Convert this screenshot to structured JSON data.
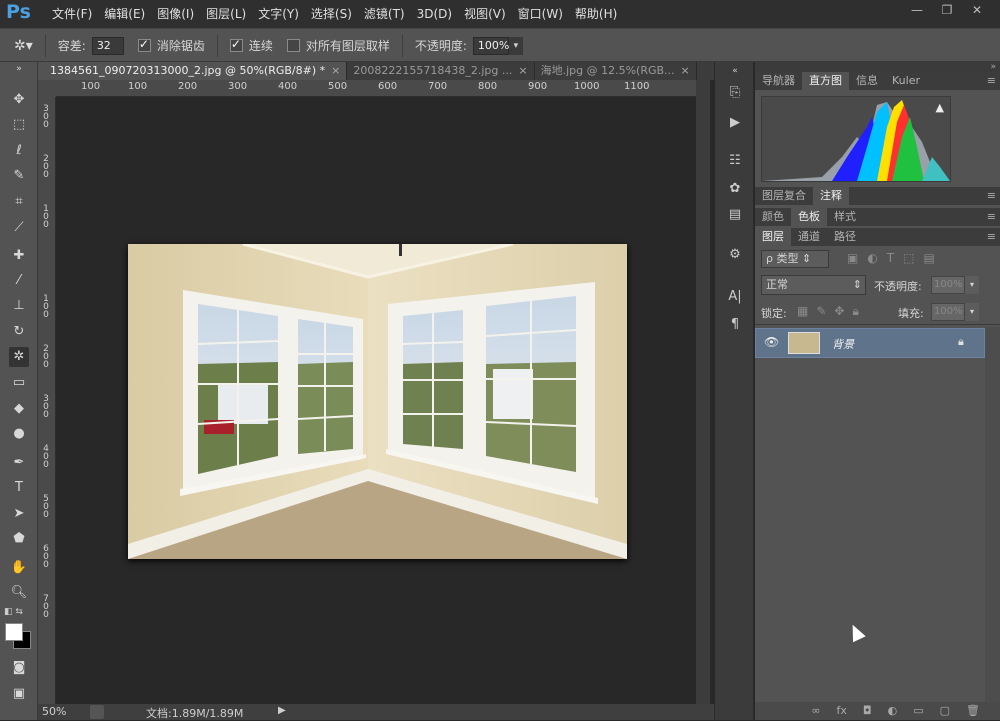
{
  "app": {
    "name": "Ps"
  },
  "menu": [
    "文件(F)",
    "编辑(E)",
    "图像(I)",
    "图层(L)",
    "文字(Y)",
    "选择(S)",
    "滤镜(T)",
    "3D(D)",
    "视图(V)",
    "窗口(W)",
    "帮助(H)"
  ],
  "window_buttons": {
    "minimize": "—",
    "restore": "❐",
    "close": "✕"
  },
  "options": {
    "tolerance_label": "容差:",
    "tolerance_value": "32",
    "antialias_label": "消除锯齿",
    "contiguous_label": "连续",
    "sample_all_label": "对所有图层取样",
    "opacity_label": "不透明度:",
    "opacity_value": "100%"
  },
  "tabs": [
    {
      "label": "1384561_090720313000_2.jpg @ 50%(RGB/8#) *",
      "close": "×"
    },
    {
      "label": "2008222155718438_2.jpg ...",
      "close": "×"
    },
    {
      "label": "海地.jpg @ 12.5%(RGB...",
      "close": "×"
    }
  ],
  "ruler_top": [
    "100",
    "100",
    "200",
    "300",
    "400",
    "500",
    "600",
    "700",
    "800",
    "900",
    "1000",
    "1100"
  ],
  "ruler_left": [
    "3\n0\n0",
    "2\n0\n0",
    "1\n0\n0",
    "1\n0\n0",
    "2\n0\n0",
    "3\n0\n0",
    "4\n0\n0",
    "5\n0\n0",
    "6\n0\n0",
    "7\n0\n0"
  ],
  "status": {
    "zoom": "50%",
    "doc": "文档:1.89M/1.89M"
  },
  "panels": {
    "top_tabs": [
      "导航器",
      "直方图",
      "信息",
      "Kuler"
    ],
    "hist_warning": "▲",
    "group2_tabs": [
      "图层复合",
      "注释"
    ],
    "group3_tabs": [
      "颜色",
      "色板",
      "样式"
    ],
    "layers_tabs": [
      "图层",
      "通道",
      "路径"
    ],
    "filter_label": "ρ 类型",
    "blend_mode": "正常",
    "opacity_label": "不透明度:",
    "opacity_value": "100%",
    "lock_label": "锁定:",
    "fill_label": "填充:",
    "fill_value": "100%",
    "layer_name": "背景",
    "bottom_icons": [
      "∞",
      "fx",
      "◘",
      "◐",
      "▭",
      "▢",
      "🗑"
    ]
  },
  "colors": {
    "accent": "#4da0e0",
    "selected_layer": "#5f738a"
  }
}
